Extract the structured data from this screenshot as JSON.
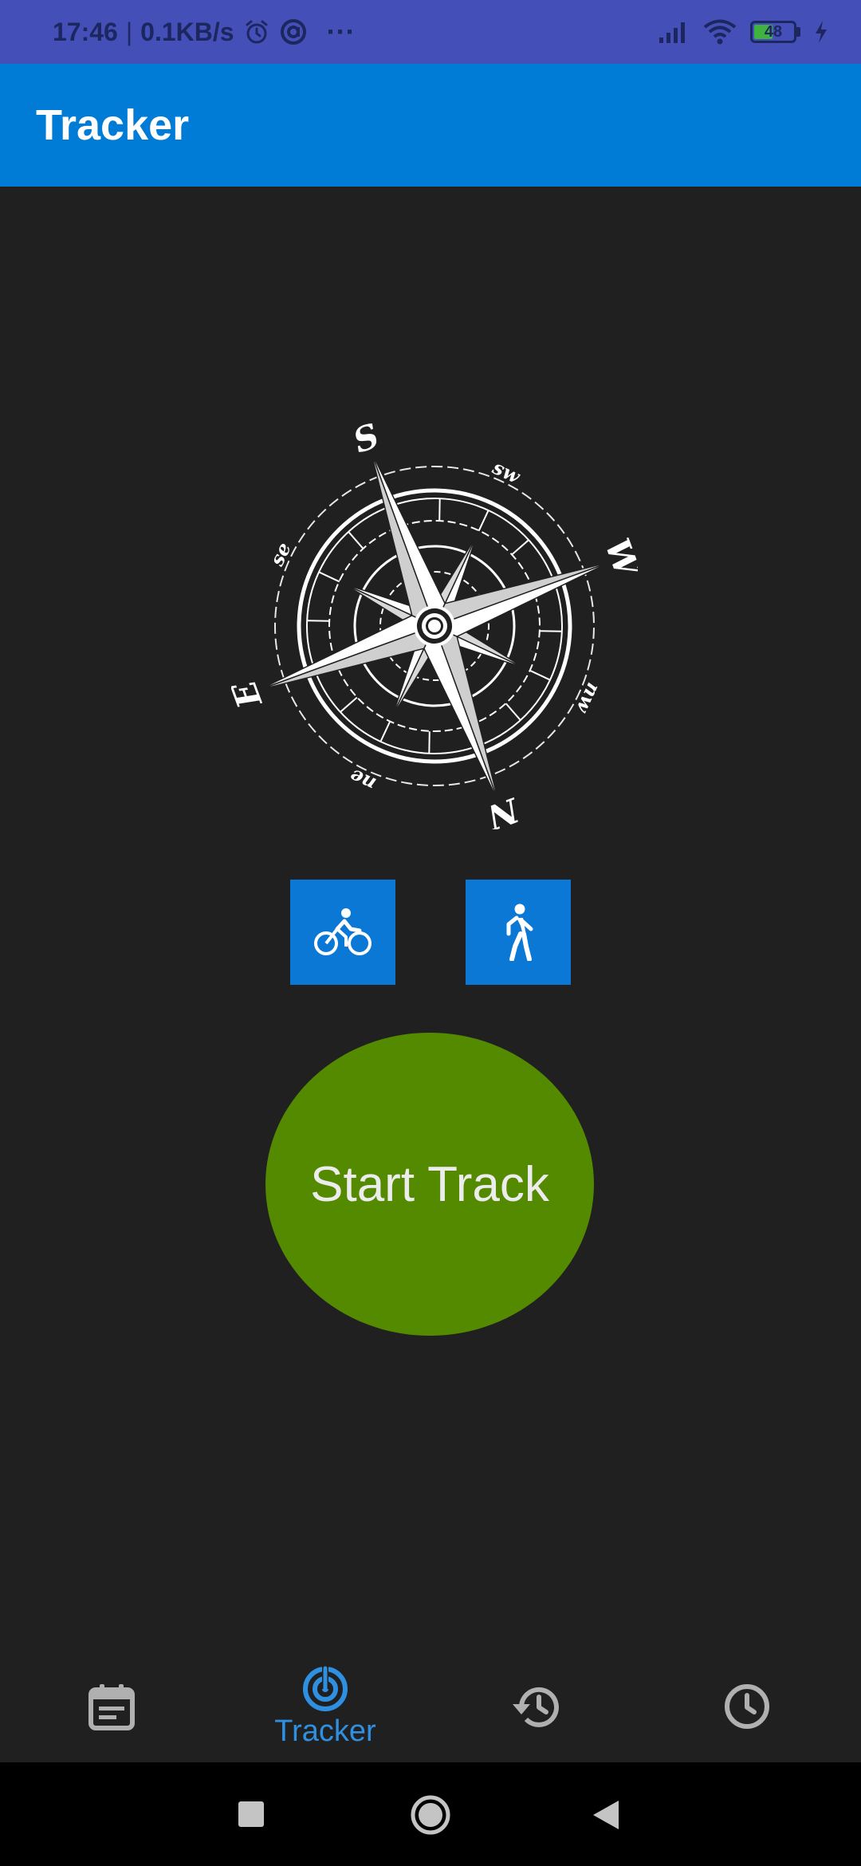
{
  "status_bar": {
    "time": "17:46",
    "separator": "|",
    "net_speed": "0.1KB/s",
    "more": "···",
    "battery_level": "48",
    "icons": [
      "alarm-icon",
      "circle-a-icon",
      "signal-icon",
      "wifi-icon",
      "battery-icon",
      "charging-icon"
    ]
  },
  "app_bar": {
    "title": "Tracker"
  },
  "compass": {
    "labels": {
      "S": "S",
      "W": "W",
      "N": "N",
      "E": "E",
      "se": "se",
      "sw": "sw",
      "nw": "nw",
      "ne": "ne"
    }
  },
  "modes": [
    {
      "name": "bike",
      "icon": "bike-icon"
    },
    {
      "name": "walk",
      "icon": "walk-icon"
    }
  ],
  "start_button": {
    "label": "Start Track",
    "color": "#548a00"
  },
  "bottom_nav": {
    "items": [
      {
        "icon": "calendar-note-icon",
        "label": ""
      },
      {
        "icon": "radar-icon",
        "label": "Tracker",
        "active": true
      },
      {
        "icon": "history-icon",
        "label": ""
      },
      {
        "icon": "clock-icon",
        "label": ""
      }
    ],
    "active_color": "#2f8fe0",
    "inactive_color": "#b0b0b0"
  },
  "system_nav": [
    "recents-square-icon",
    "home-circle-icon",
    "back-triangle-icon"
  ],
  "colors": {
    "background": "#202020",
    "status_bar": "#4450b8",
    "app_bar": "#007bd6",
    "mode_button": "#0a78d4"
  }
}
